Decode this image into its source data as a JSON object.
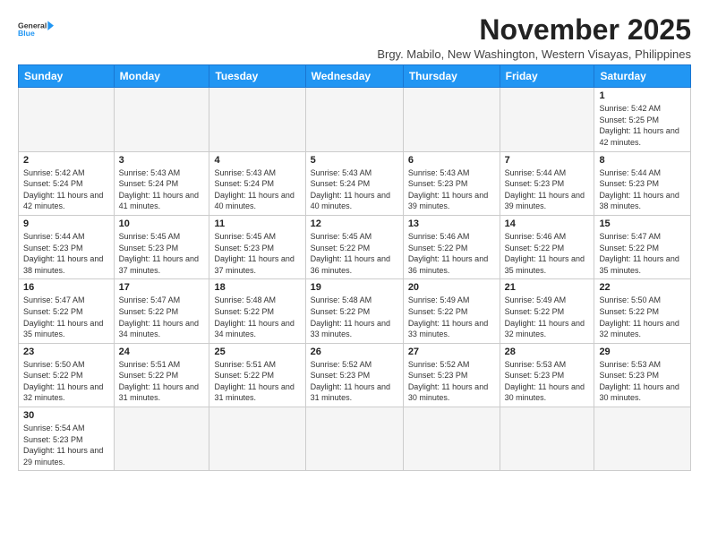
{
  "header": {
    "logo_line1": "General",
    "logo_line2": "Blue",
    "month_title": "November 2025",
    "location": "Brgy. Mabilo, New Washington, Western Visayas, Philippines"
  },
  "days_of_week": [
    "Sunday",
    "Monday",
    "Tuesday",
    "Wednesday",
    "Thursday",
    "Friday",
    "Saturday"
  ],
  "weeks": [
    [
      {
        "day": "",
        "sunrise": "",
        "sunset": "",
        "daylight": ""
      },
      {
        "day": "",
        "sunrise": "",
        "sunset": "",
        "daylight": ""
      },
      {
        "day": "",
        "sunrise": "",
        "sunset": "",
        "daylight": ""
      },
      {
        "day": "",
        "sunrise": "",
        "sunset": "",
        "daylight": ""
      },
      {
        "day": "",
        "sunrise": "",
        "sunset": "",
        "daylight": ""
      },
      {
        "day": "",
        "sunrise": "",
        "sunset": "",
        "daylight": ""
      },
      {
        "day": "1",
        "sunrise": "Sunrise: 5:42 AM",
        "sunset": "Sunset: 5:25 PM",
        "daylight": "Daylight: 11 hours and 42 minutes."
      }
    ],
    [
      {
        "day": "2",
        "sunrise": "Sunrise: 5:42 AM",
        "sunset": "Sunset: 5:24 PM",
        "daylight": "Daylight: 11 hours and 42 minutes."
      },
      {
        "day": "3",
        "sunrise": "Sunrise: 5:43 AM",
        "sunset": "Sunset: 5:24 PM",
        "daylight": "Daylight: 11 hours and 41 minutes."
      },
      {
        "day": "4",
        "sunrise": "Sunrise: 5:43 AM",
        "sunset": "Sunset: 5:24 PM",
        "daylight": "Daylight: 11 hours and 40 minutes."
      },
      {
        "day": "5",
        "sunrise": "Sunrise: 5:43 AM",
        "sunset": "Sunset: 5:24 PM",
        "daylight": "Daylight: 11 hours and 40 minutes."
      },
      {
        "day": "6",
        "sunrise": "Sunrise: 5:43 AM",
        "sunset": "Sunset: 5:23 PM",
        "daylight": "Daylight: 11 hours and 39 minutes."
      },
      {
        "day": "7",
        "sunrise": "Sunrise: 5:44 AM",
        "sunset": "Sunset: 5:23 PM",
        "daylight": "Daylight: 11 hours and 39 minutes."
      },
      {
        "day": "8",
        "sunrise": "Sunrise: 5:44 AM",
        "sunset": "Sunset: 5:23 PM",
        "daylight": "Daylight: 11 hours and 38 minutes."
      }
    ],
    [
      {
        "day": "9",
        "sunrise": "Sunrise: 5:44 AM",
        "sunset": "Sunset: 5:23 PM",
        "daylight": "Daylight: 11 hours and 38 minutes."
      },
      {
        "day": "10",
        "sunrise": "Sunrise: 5:45 AM",
        "sunset": "Sunset: 5:23 PM",
        "daylight": "Daylight: 11 hours and 37 minutes."
      },
      {
        "day": "11",
        "sunrise": "Sunrise: 5:45 AM",
        "sunset": "Sunset: 5:23 PM",
        "daylight": "Daylight: 11 hours and 37 minutes."
      },
      {
        "day": "12",
        "sunrise": "Sunrise: 5:45 AM",
        "sunset": "Sunset: 5:22 PM",
        "daylight": "Daylight: 11 hours and 36 minutes."
      },
      {
        "day": "13",
        "sunrise": "Sunrise: 5:46 AM",
        "sunset": "Sunset: 5:22 PM",
        "daylight": "Daylight: 11 hours and 36 minutes."
      },
      {
        "day": "14",
        "sunrise": "Sunrise: 5:46 AM",
        "sunset": "Sunset: 5:22 PM",
        "daylight": "Daylight: 11 hours and 35 minutes."
      },
      {
        "day": "15",
        "sunrise": "Sunrise: 5:47 AM",
        "sunset": "Sunset: 5:22 PM",
        "daylight": "Daylight: 11 hours and 35 minutes."
      }
    ],
    [
      {
        "day": "16",
        "sunrise": "Sunrise: 5:47 AM",
        "sunset": "Sunset: 5:22 PM",
        "daylight": "Daylight: 11 hours and 35 minutes."
      },
      {
        "day": "17",
        "sunrise": "Sunrise: 5:47 AM",
        "sunset": "Sunset: 5:22 PM",
        "daylight": "Daylight: 11 hours and 34 minutes."
      },
      {
        "day": "18",
        "sunrise": "Sunrise: 5:48 AM",
        "sunset": "Sunset: 5:22 PM",
        "daylight": "Daylight: 11 hours and 34 minutes."
      },
      {
        "day": "19",
        "sunrise": "Sunrise: 5:48 AM",
        "sunset": "Sunset: 5:22 PM",
        "daylight": "Daylight: 11 hours and 33 minutes."
      },
      {
        "day": "20",
        "sunrise": "Sunrise: 5:49 AM",
        "sunset": "Sunset: 5:22 PM",
        "daylight": "Daylight: 11 hours and 33 minutes."
      },
      {
        "day": "21",
        "sunrise": "Sunrise: 5:49 AM",
        "sunset": "Sunset: 5:22 PM",
        "daylight": "Daylight: 11 hours and 32 minutes."
      },
      {
        "day": "22",
        "sunrise": "Sunrise: 5:50 AM",
        "sunset": "Sunset: 5:22 PM",
        "daylight": "Daylight: 11 hours and 32 minutes."
      }
    ],
    [
      {
        "day": "23",
        "sunrise": "Sunrise: 5:50 AM",
        "sunset": "Sunset: 5:22 PM",
        "daylight": "Daylight: 11 hours and 32 minutes."
      },
      {
        "day": "24",
        "sunrise": "Sunrise: 5:51 AM",
        "sunset": "Sunset: 5:22 PM",
        "daylight": "Daylight: 11 hours and 31 minutes."
      },
      {
        "day": "25",
        "sunrise": "Sunrise: 5:51 AM",
        "sunset": "Sunset: 5:22 PM",
        "daylight": "Daylight: 11 hours and 31 minutes."
      },
      {
        "day": "26",
        "sunrise": "Sunrise: 5:52 AM",
        "sunset": "Sunset: 5:23 PM",
        "daylight": "Daylight: 11 hours and 31 minutes."
      },
      {
        "day": "27",
        "sunrise": "Sunrise: 5:52 AM",
        "sunset": "Sunset: 5:23 PM",
        "daylight": "Daylight: 11 hours and 30 minutes."
      },
      {
        "day": "28",
        "sunrise": "Sunrise: 5:53 AM",
        "sunset": "Sunset: 5:23 PM",
        "daylight": "Daylight: 11 hours and 30 minutes."
      },
      {
        "day": "29",
        "sunrise": "Sunrise: 5:53 AM",
        "sunset": "Sunset: 5:23 PM",
        "daylight": "Daylight: 11 hours and 30 minutes."
      }
    ],
    [
      {
        "day": "30",
        "sunrise": "Sunrise: 5:54 AM",
        "sunset": "Sunset: 5:23 PM",
        "daylight": "Daylight: 11 hours and 29 minutes."
      },
      {
        "day": "",
        "sunrise": "",
        "sunset": "",
        "daylight": ""
      },
      {
        "day": "",
        "sunrise": "",
        "sunset": "",
        "daylight": ""
      },
      {
        "day": "",
        "sunrise": "",
        "sunset": "",
        "daylight": ""
      },
      {
        "day": "",
        "sunrise": "",
        "sunset": "",
        "daylight": ""
      },
      {
        "day": "",
        "sunrise": "",
        "sunset": "",
        "daylight": ""
      },
      {
        "day": "",
        "sunrise": "",
        "sunset": "",
        "daylight": ""
      }
    ]
  ]
}
